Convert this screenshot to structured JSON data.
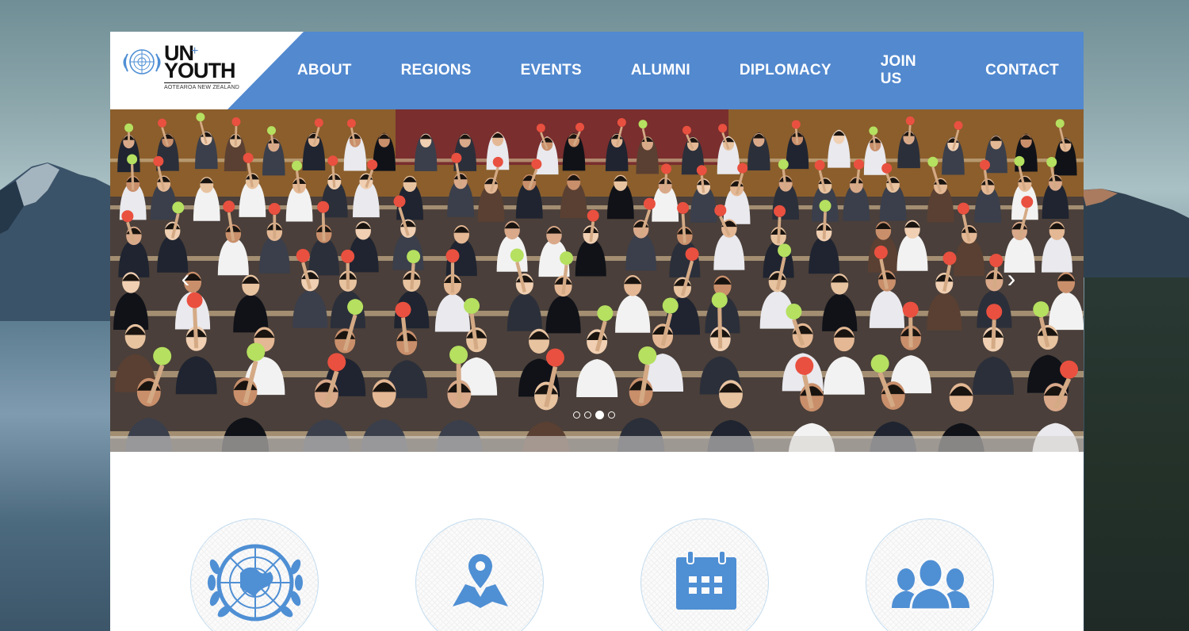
{
  "brand": {
    "line1": "UN",
    "plus": "+",
    "line2": "YOUTH",
    "subtitle": "AOTEAROA NEW ZEALAND"
  },
  "nav": {
    "items": [
      {
        "label": "ABOUT"
      },
      {
        "label": "REGIONS"
      },
      {
        "label": "EVENTS"
      },
      {
        "label": "ALUMNI"
      },
      {
        "label": "DIPLOMACY"
      },
      {
        "label": "JOIN US"
      },
      {
        "label": "CONTACT"
      }
    ]
  },
  "slider": {
    "slide_count": 4,
    "active_slide": 3,
    "image": "photo of youth delegates in a lecture hall holding up red and green voting cards"
  },
  "features": [
    {
      "icon": "un-emblem-icon"
    },
    {
      "icon": "map-pin-icon"
    },
    {
      "icon": "calendar-icon"
    },
    {
      "icon": "people-group-icon"
    }
  ],
  "colors": {
    "brand_blue": "#5289cf",
    "icon_blue": "#4f8fd4",
    "card_red": "#e9503f",
    "card_green": "#b5e060"
  }
}
